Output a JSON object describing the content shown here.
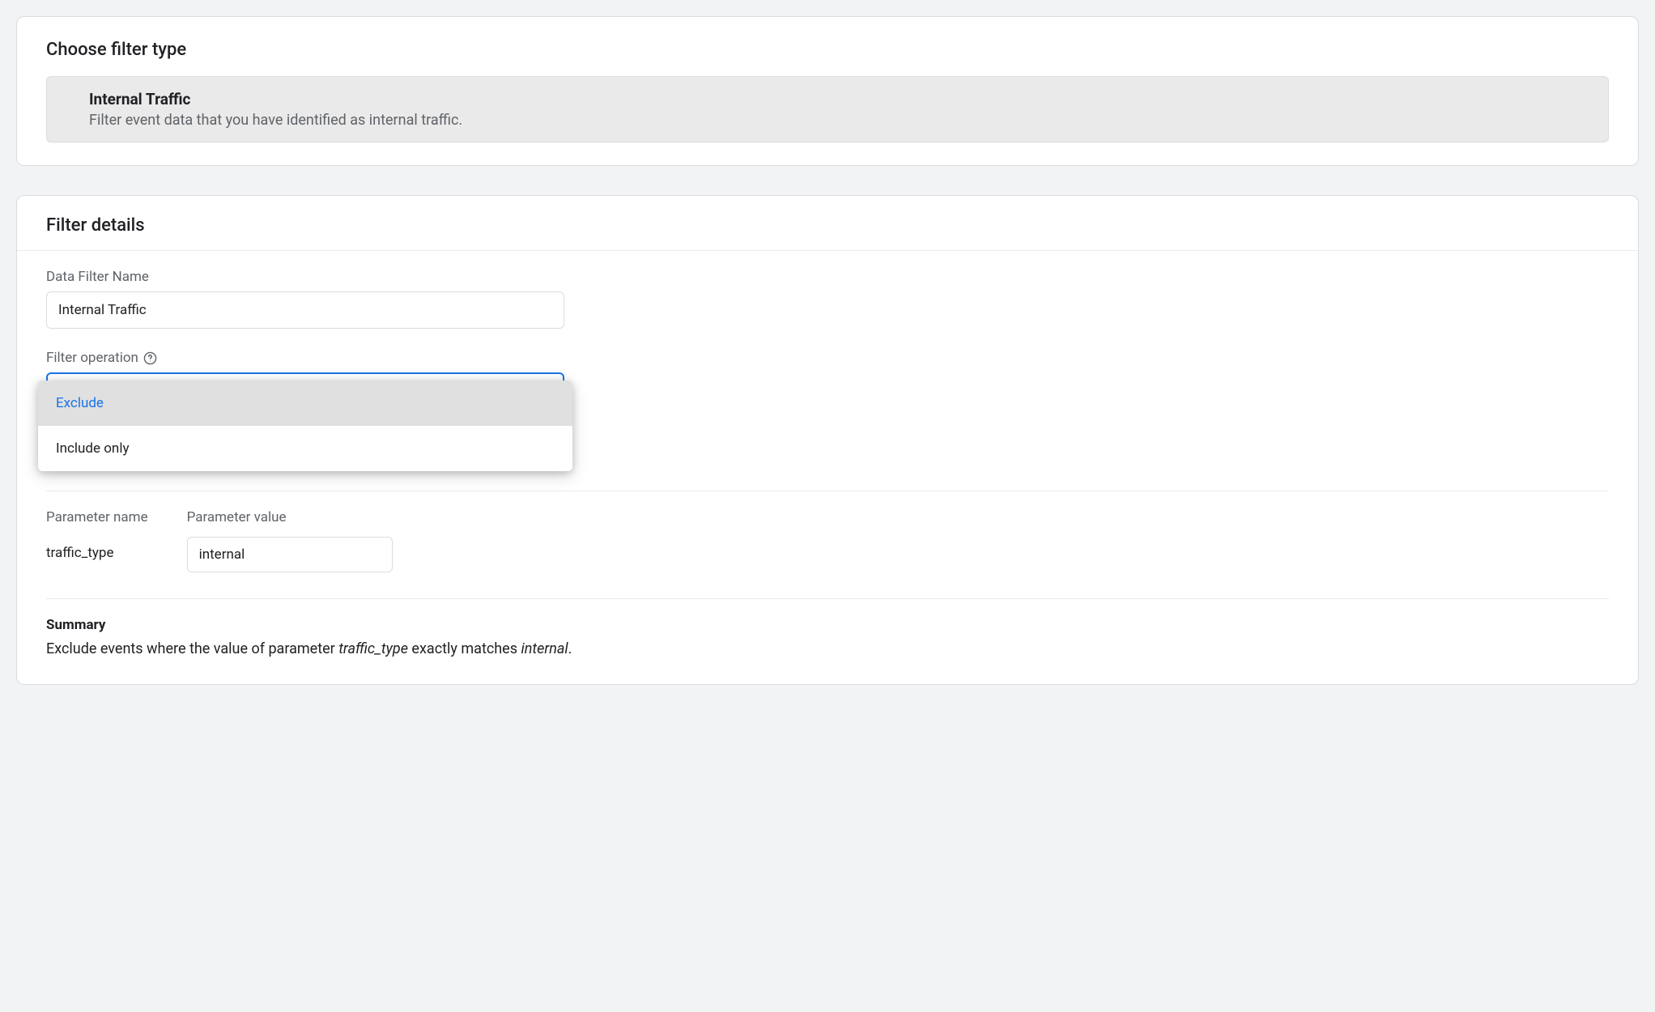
{
  "filterType": {
    "sectionTitle": "Choose filter type",
    "optionTitle": "Internal Traffic",
    "optionDesc": "Filter event data that you have identified as internal traffic."
  },
  "details": {
    "sectionTitle": "Filter details",
    "nameLabel": "Data Filter Name",
    "nameValue": "Internal Traffic",
    "operationLabel": "Filter operation",
    "operationOptions": [
      {
        "label": "Exclude",
        "selected": true
      },
      {
        "label": "Include only",
        "selected": false
      }
    ],
    "paramNameLabel": "Parameter name",
    "paramNameValue": "traffic_type",
    "paramValueLabel": "Parameter value",
    "paramValueValue": "internal",
    "summaryTitle": "Summary",
    "summaryPrefix": "Exclude events where the value of parameter ",
    "summaryParam": "traffic_type",
    "summaryMid": " exactly matches ",
    "summaryValue": "internal",
    "summarySuffix": "."
  }
}
